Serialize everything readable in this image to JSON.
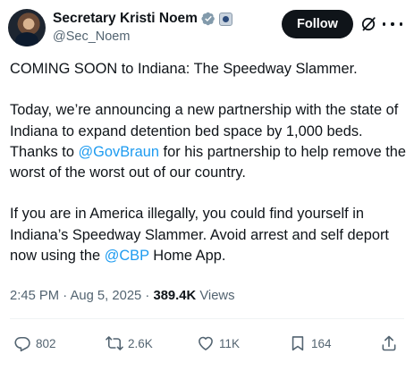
{
  "author": {
    "display_name": "Secretary Kristi Noem",
    "handle": "@Sec_Noem"
  },
  "header": {
    "follow_label": "Follow"
  },
  "post": {
    "para1": "COMING SOON to Indiana: The Speedway Slammer.",
    "para2_part1": "Today, we’re announcing a new partnership with the state of Indiana to expand detention bed space by 1,000 beds. Thanks to ",
    "para2_mention": "@GovBraun",
    "para2_part2": " for his partnership to help remove the worst of the worst out of our country.",
    "para3_part1": "If you are in America illegally, you could find yourself in Indiana’s Speedway Slammer. Avoid arrest and self deport now using the ",
    "para3_mention": "@CBP",
    "para3_part2": " Home App."
  },
  "meta": {
    "time": "2:45 PM",
    "separator": "·",
    "date": "Aug 5, 2025",
    "views_count": "389.4K",
    "views_label": "Views"
  },
  "actions": {
    "replies": "802",
    "reposts": "2.6K",
    "likes": "11K",
    "bookmarks": "164"
  },
  "icons": {
    "verified": "verified-badge-icon",
    "affiliate": "government-affiliate-icon",
    "grok": "grok-icon",
    "more": "more-icon",
    "reply": "reply-icon",
    "repost": "repost-icon",
    "like": "heart-icon",
    "bookmark": "bookmark-icon",
    "share": "share-icon"
  },
  "colors": {
    "text": "#0f1419",
    "secondary": "#536471",
    "mention": "#1d9bf0",
    "verified_badge": "#829aab",
    "follow_bg": "#0f1419"
  }
}
